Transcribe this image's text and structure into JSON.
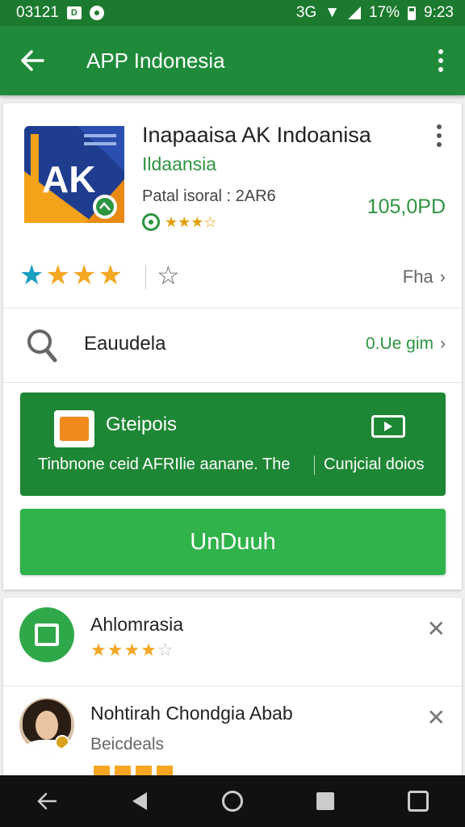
{
  "status_bar": {
    "carrier": "03121",
    "time": "9:23",
    "battery": "17%",
    "network": "3G"
  },
  "app_bar": {
    "title": "APP Indonesia"
  },
  "app": {
    "name": "Inapaaisa AK Indoanisa",
    "developer": "Ildaansia",
    "meta": "Patal isoral : 2AR6",
    "price": "105,0PD",
    "icon_letters": "AK"
  },
  "rating": {
    "filled_stars": 4,
    "link_label": "Fha"
  },
  "search_row": {
    "label": "Eauudela",
    "link": "0.Ue gim"
  },
  "promo": {
    "title": "Gteipois",
    "description": "Tinbnone ceid AFRIlie aanane. The",
    "link": "Cunjcial doios"
  },
  "install_button": {
    "label": "UnDuuh"
  },
  "suggestions": [
    {
      "title": "Ahlomrasia",
      "rating": 3.5
    },
    {
      "title": "Nohtirah Chondgia Abab",
      "subtitle": "Beicdeals"
    }
  ],
  "colors": {
    "primary": "#1f8b3a",
    "accent_green": "#2fb34a",
    "star": "#f5a623"
  }
}
